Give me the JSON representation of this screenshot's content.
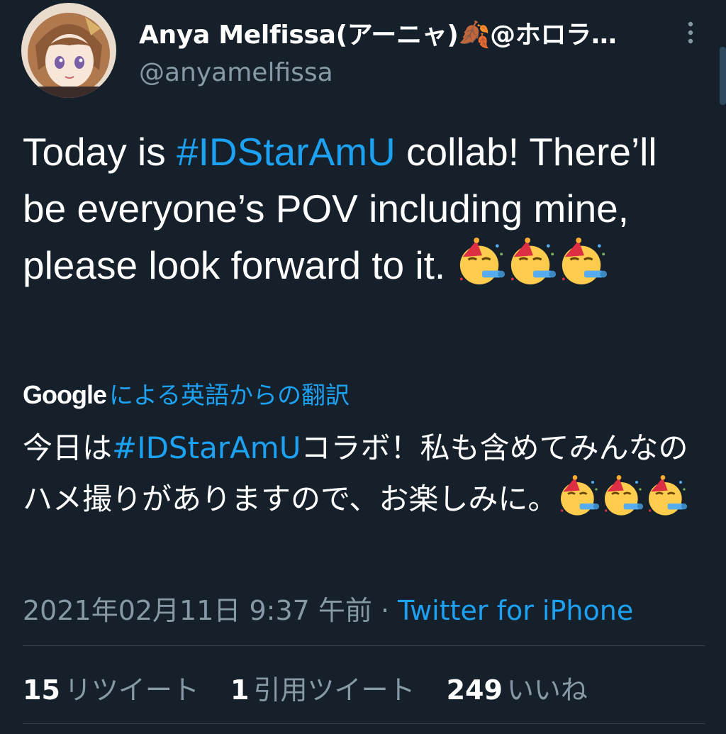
{
  "author": {
    "display_name": "Anya Melfissa(アーニャ)🍂@ホロラ…",
    "handle": "@anyamelfissa"
  },
  "tweet": {
    "text_parts": [
      "Today is ",
      "#IDStarAmU",
      " collab! There’ll be everyone’s POV including mine, please look forward to it. "
    ],
    "emoji": "partying-face-emoji"
  },
  "translation": {
    "provider": "Google",
    "label": "による英語からの翻訳",
    "text_parts": [
      "今日は",
      "#IDStarAmU",
      "コラボ！私も含めてみんなのハメ撮りがありますので、お楽しみに。"
    ]
  },
  "meta": {
    "timestamp": "2021年02月11日 9:37 午前",
    "separator": " · ",
    "source": "Twitter for iPhone"
  },
  "stats": {
    "retweets_count": "15",
    "retweets_label": "リツイート",
    "quotes_count": "1",
    "quotes_label": "引用ツイート",
    "likes_count": "249",
    "likes_label": "いいね"
  },
  "colors": {
    "background": "#15202b",
    "link": "#1da1f2",
    "secondary_text": "#8899a6"
  }
}
